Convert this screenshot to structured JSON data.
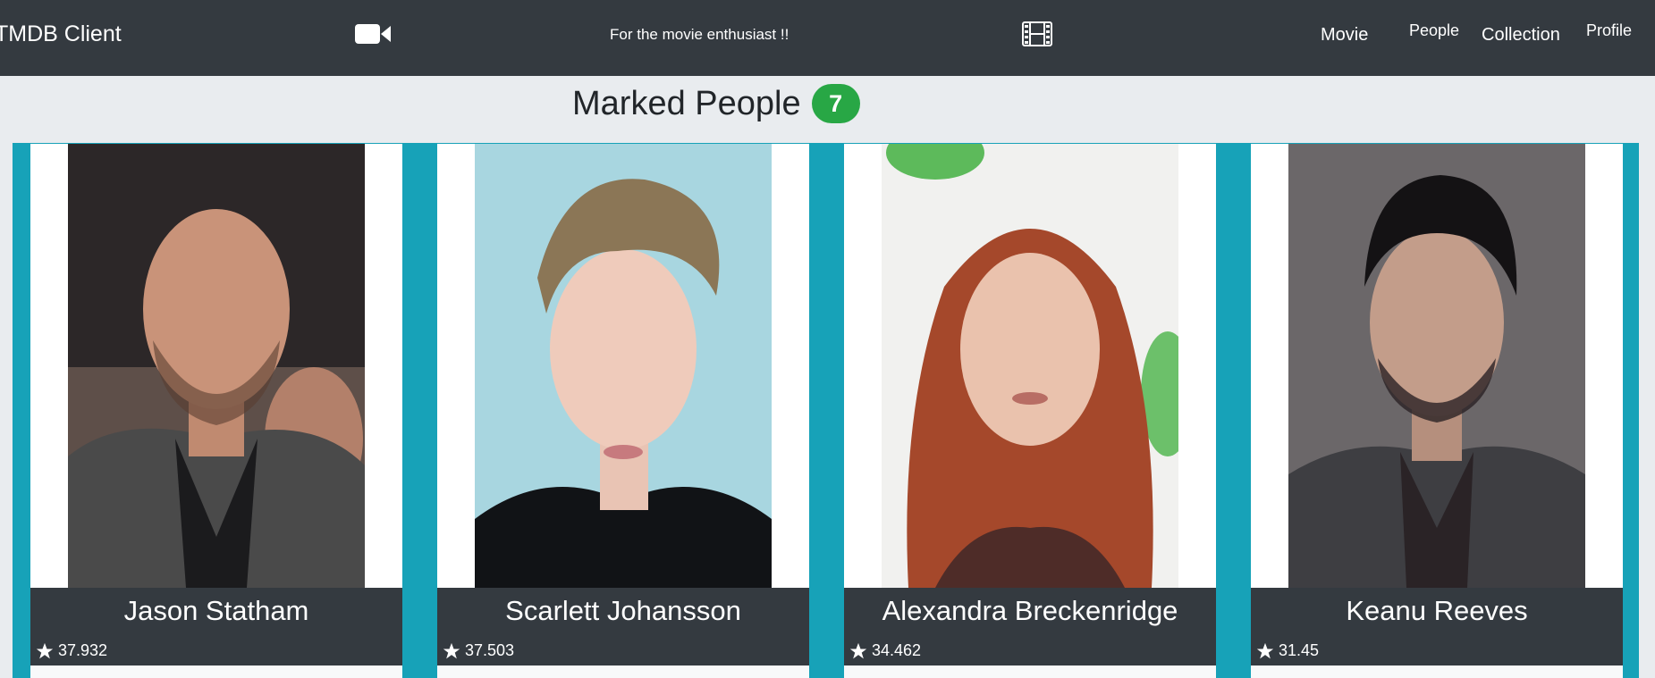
{
  "navbar": {
    "brand": "TMDB Client",
    "tagline": "For the movie enthusiast !!",
    "camera_icon": "video-camera-icon",
    "film_icon": "film-strip-icon",
    "links": {
      "movie": "Movie",
      "people": "People",
      "collection": "Collection",
      "profile": "Profile"
    }
  },
  "heading": {
    "title": "Marked People",
    "count": "7",
    "badge_color": "#28a745"
  },
  "colors": {
    "navbar": "#343a40",
    "accent": "#17a2b8",
    "background": "#e9ecef"
  },
  "people": [
    {
      "name": "Jason Statham",
      "rating": "37.932"
    },
    {
      "name": "Scarlett Johansson",
      "rating": "37.503"
    },
    {
      "name": "Alexandra Breckenridge",
      "rating": "34.462"
    },
    {
      "name": "Keanu Reeves",
      "rating": "31.45"
    }
  ]
}
